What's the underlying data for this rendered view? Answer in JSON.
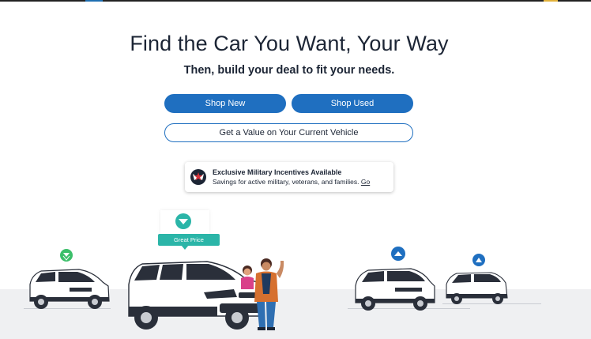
{
  "hero": {
    "title": "Find the Car You Want, Your Way",
    "subtitle": "Then, build your deal to fit your needs."
  },
  "actions": {
    "shop_new": "Shop New",
    "shop_used": "Shop Used",
    "trade_value": "Get a Value on Your Current Vehicle"
  },
  "promo": {
    "title": "Exclusive Military Incentives Available",
    "description": "Savings for active military, veterans, and families.",
    "link": "Go",
    "icon": "military-star-icon"
  },
  "price_badges": {
    "great_price_label": "Great Price",
    "icons": [
      "price-down-icon",
      "price-down-icon",
      "price-up-icon",
      "price-up-icon"
    ]
  },
  "colors": {
    "primary": "#1f6fc0",
    "teal": "#2bb5a8",
    "green": "#3cbf6a",
    "text": "#1c2535"
  }
}
